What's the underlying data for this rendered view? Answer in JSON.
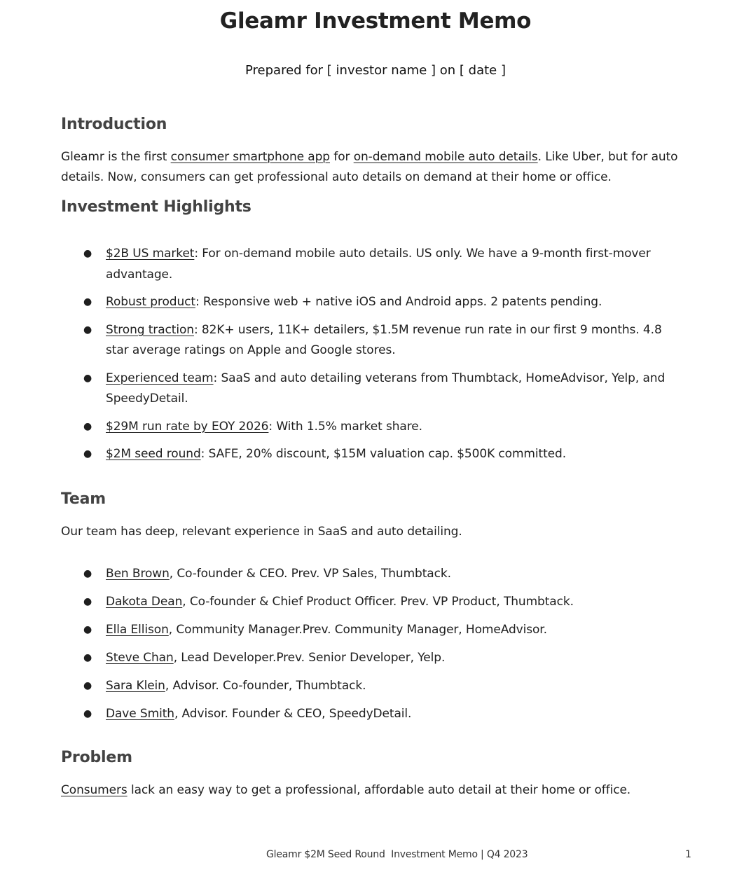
{
  "title": "Gleamr Investment Memo",
  "subtitle": "Prepared for [ investor name ] on [ date ]",
  "introduction": {
    "heading": "Introduction",
    "text_1": "Gleamr is the first ",
    "link_1": "consumer smartphone app",
    "text_2": " for ",
    "link_2": "on-demand mobile auto details",
    "text_3": ". Like Uber, but for auto details. Now, consumers can get professional auto details on demand at their home or office."
  },
  "highlights": {
    "heading": "Investment Highlights",
    "items": [
      {
        "link": "$2B US market",
        "text": ": For on-demand mobile auto details. US only. We have a 9-month first-mover advantage."
      },
      {
        "link": "Robust product",
        "text": ": Responsive web + native iOS and Android apps. 2 patents pending."
      },
      {
        "link": "Strong traction",
        "text": ": 82K+ users, 11K+ detailers, $1.5M revenue run rate in our first 9 months. 4.8 star average ratings on Apple and Google stores."
      },
      {
        "link": "Experienced team",
        "text": ": SaaS and auto detailing veterans from Thumbtack, HomeAdvisor, Yelp, and SpeedyDetail."
      },
      {
        "link": "$29M run rate by EOY 2026",
        "text": ": With 1.5% market share."
      },
      {
        "link": "$2M seed round",
        "text": ": SAFE, 20% discount, $15M valuation cap. $500K committed."
      }
    ]
  },
  "team": {
    "heading": "Team",
    "intro": "Our team has deep, relevant experience in SaaS and auto detailing.",
    "members": [
      {
        "name": "Ben Brown",
        "text": ", Co-founder & CEO. Prev. VP Sales, Thumbtack."
      },
      {
        "name": "Dakota Dean",
        "text": ", Co-founder & Chief Product Officer. Prev. VP Product, Thumbtack."
      },
      {
        "name": "Ella Ellison",
        "text": ", Community Manager.Prev. Community Manager, HomeAdvisor."
      },
      {
        "name": "Steve Chan",
        "text": ", Lead Developer.Prev. Senior Developer, Yelp."
      },
      {
        "name": "Sara Klein",
        "text": ", Advisor. Co-founder, Thumbtack."
      },
      {
        "name": "Dave Smith",
        "text": ", Advisor. Founder & CEO, SpeedyDetail."
      }
    ]
  },
  "problem": {
    "heading": "Problem",
    "link": "Consumers",
    "text": " lack an easy way to get a professional, affordable auto detail at their home or office."
  },
  "footer": {
    "text": "Gleamr $2M Seed Round  Investment Memo | Q4 2023",
    "page_number": "1"
  },
  "bullet_glyph": "●"
}
